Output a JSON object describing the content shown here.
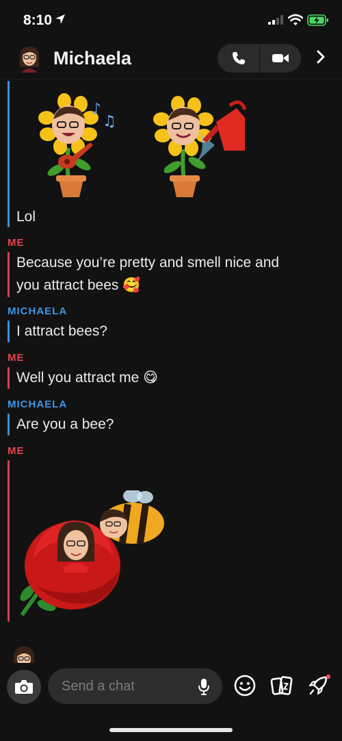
{
  "status_bar": {
    "time": "8:10"
  },
  "header": {
    "contact_name": "Michaela"
  },
  "messages": [
    {
      "sender": "",
      "text": "Lol"
    },
    {
      "sender": "ME",
      "text": "Because you’re pretty and smell nice and"
    },
    {
      "sender": "",
      "text": "you attract bees 🥰"
    },
    {
      "sender": "MICHAELA",
      "text": "I attract bees?"
    },
    {
      "sender": "ME",
      "text": "Well you attract me 😋"
    },
    {
      "sender": "MICHAELA",
      "text": "Are you a bee?"
    },
    {
      "sender": "ME",
      "text": ""
    }
  ],
  "input": {
    "placeholder": "Send a chat"
  },
  "colors": {
    "me": "#e0454f",
    "her": "#3e96e8",
    "background": "#121212"
  },
  "icons": [
    "location-arrow-icon",
    "signal-icon",
    "wifi-icon",
    "battery-charging-icon",
    "phone-icon",
    "video-camera-icon",
    "chevron-right-icon",
    "camera-icon",
    "microphone-icon",
    "smiley-icon",
    "cards-icon",
    "rocket-icon"
  ]
}
